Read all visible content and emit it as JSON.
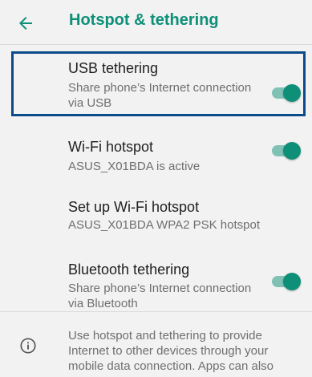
{
  "header": {
    "title": "Hotspot & tethering",
    "back_icon": "arrow-back-icon"
  },
  "items": [
    {
      "title": "USB tethering",
      "subtitle": "Share phone’s Internet connection via USB",
      "toggle_on": true
    },
    {
      "title": "Wi-Fi hotspot",
      "subtitle": "ASUS_X01BDA is active",
      "toggle_on": true
    },
    {
      "title": "Set up Wi-Fi hotspot",
      "subtitle": "ASUS_X01BDA WPA2 PSK hotspot"
    },
    {
      "title": "Bluetooth tethering",
      "subtitle": "Share phone’s Internet connection via Bluetooth",
      "toggle_on": true
    }
  ],
  "info": {
    "icon": "info-icon",
    "text": "Use hotspot and tethering to provide Internet to other devices through your mobile data connection. Apps can also"
  },
  "colors": {
    "accent": "#0e8f78",
    "track": "#7fc2b5",
    "highlight": "#0b4a8b"
  }
}
